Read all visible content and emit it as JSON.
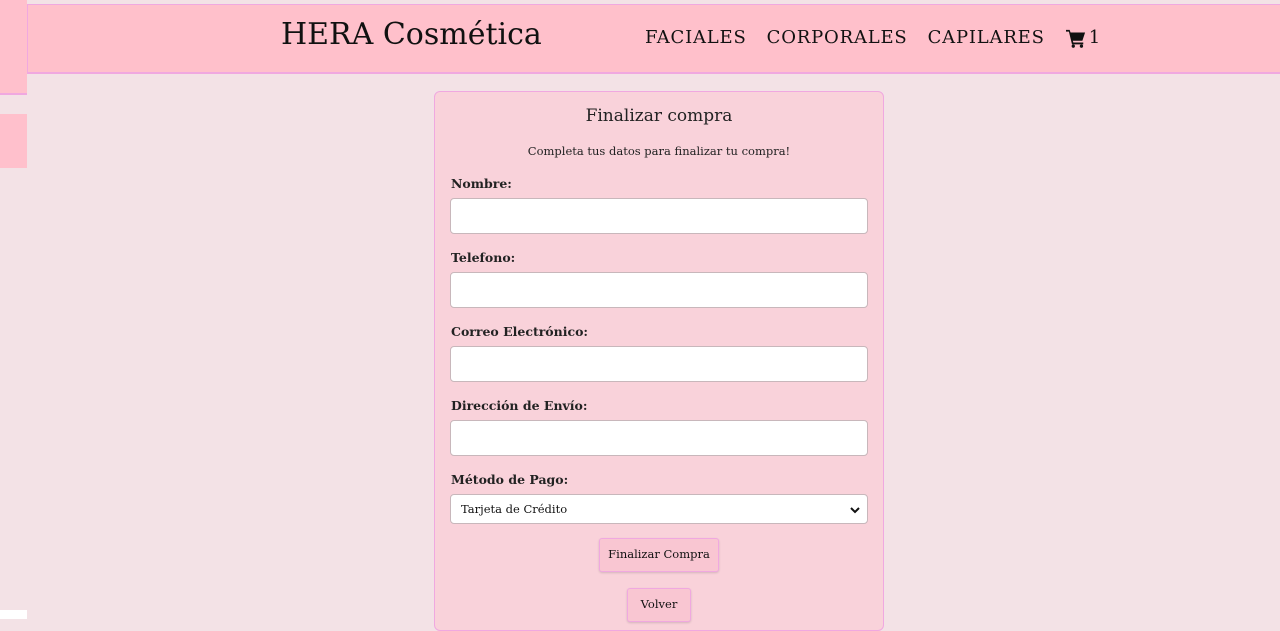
{
  "header": {
    "brand": "HERA Cosmética",
    "nav": [
      "FACIALES",
      "CORPORALES",
      "CAPILARES"
    ],
    "cart_icon": "shopping-cart-icon",
    "cart_count": "1"
  },
  "checkout": {
    "title": "Finalizar compra",
    "subtitle": "Completa tus datos para finalizar tu compra!",
    "fields": {
      "nombre": {
        "label": "Nombre:",
        "value": ""
      },
      "telefono": {
        "label": "Telefono:",
        "value": ""
      },
      "correo": {
        "label": "Correo Electrónico:",
        "value": ""
      },
      "direccion": {
        "label": "Dirección de Envío:",
        "value": ""
      }
    },
    "payment": {
      "label": "Método de Pago:",
      "selected": "Tarjeta de Crédito"
    },
    "submit_label": "Finalizar Compra",
    "back_label": "Volver"
  },
  "colors": {
    "background": "#f3e2e6",
    "navbar": "#ffc0cb",
    "card": "#f9d2da",
    "accent_border": "#f0a8e0"
  }
}
